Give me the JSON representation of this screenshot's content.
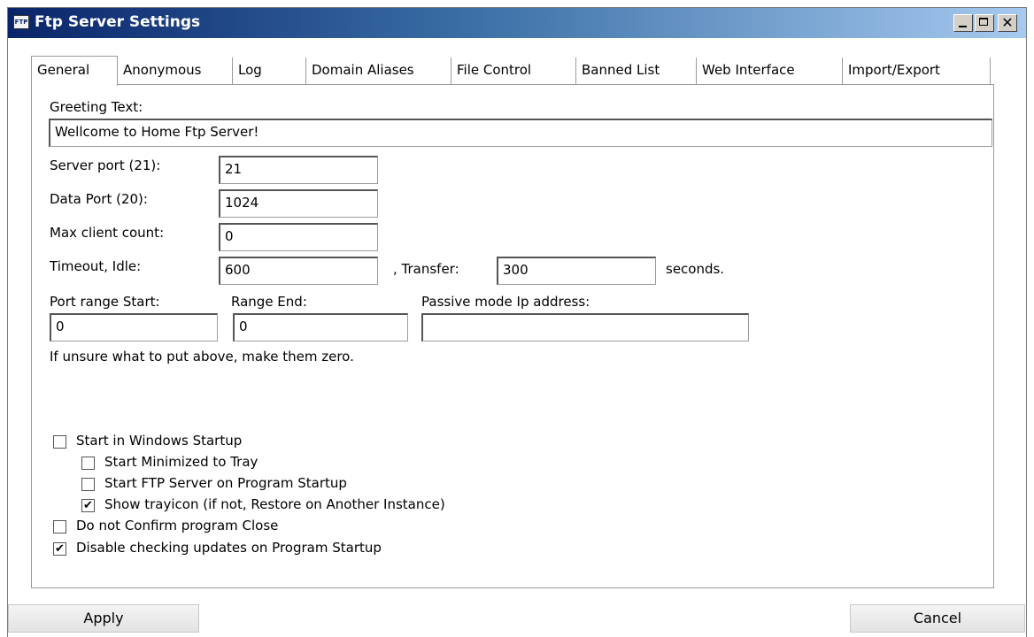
{
  "window": {
    "title": "Ftp Server Settings",
    "app_icon": "FTP"
  },
  "tabs": [
    {
      "label": "General"
    },
    {
      "label": "Anonymous"
    },
    {
      "label": "Log"
    },
    {
      "label": "Domain Aliases"
    },
    {
      "label": "File Control"
    },
    {
      "label": "Banned List"
    },
    {
      "label": "Web Interface"
    },
    {
      "label": "Import/Export"
    }
  ],
  "general": {
    "greeting_label": "Greeting Text:",
    "greeting_value": "Wellcome to Home Ftp Server!",
    "server_port_label": "Server port (21):",
    "server_port_value": "21",
    "data_port_label": "Data Port (20):",
    "data_port_value": "1024",
    "max_client_label": "Max client count:",
    "max_client_value": "0",
    "timeout_idle_label": "Timeout, Idle:",
    "timeout_idle_value": "600",
    "transfer_label": ", Transfer:",
    "transfer_value": "300",
    "seconds_label": "seconds.",
    "port_range_start_label": "Port range Start:",
    "port_range_start_value": "0",
    "range_end_label": "Range End:",
    "range_end_value": "0",
    "passive_ip_label": "Passive mode Ip address:",
    "passive_ip_value": "",
    "hint": "If unsure what to put above, make them zero."
  },
  "options": {
    "start_windows": {
      "label": "Start in Windows Startup",
      "checked": false
    },
    "start_minimized": {
      "label": "Start Minimized to Tray",
      "checked": false
    },
    "start_ftp": {
      "label": "Start FTP Server on Program Startup",
      "checked": false
    },
    "show_trayicon": {
      "label": "Show trayicon (if not, Restore on Another Instance)",
      "checked": true
    },
    "no_confirm_close": {
      "label": "Do not Confirm program Close",
      "checked": false
    },
    "disable_updates": {
      "label": "Disable checking updates on Program Startup",
      "checked": true
    },
    "check_mark": "✔"
  },
  "buttons": {
    "apply": "Apply",
    "cancel": "Cancel"
  }
}
